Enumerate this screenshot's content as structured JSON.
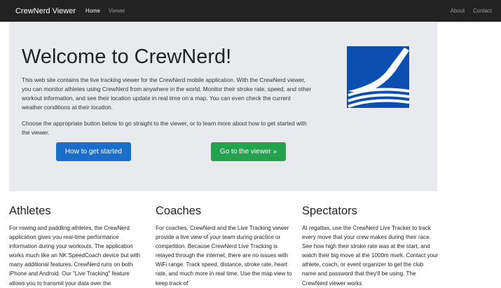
{
  "navbar": {
    "brand": "CrewNerd Viewer",
    "left_links": [
      {
        "label": "Home",
        "active": true
      },
      {
        "label": "Viewer",
        "active": false
      }
    ],
    "right_links": [
      {
        "label": "About"
      },
      {
        "label": "Contact"
      }
    ]
  },
  "jumbotron": {
    "title": "Welcome to CrewNerd!",
    "paragraph1": "This web site contains the live tracking viewer for the CrewNerd mobile application. With the CrewNerd viewer, you can monitor athletes using CrewNerd from anywhere in the world. Monitor their stroke rate, speed, and other workout information, and see their location update in real time on a map. You can even check the current weather conditions at their location.",
    "paragraph2": "Choose the appropriate button below to go straight to the viewer, or to learn more about how to get started with the viewer.",
    "btn_get_started": "How to get started",
    "btn_viewer": "Go to the viewer »",
    "logo_icon": "crewnerd-oar-logo-icon",
    "logo_color": "#0b4fb0"
  },
  "columns": [
    {
      "heading": "Athletes",
      "text": "For rowing and paddling athletes, the CrewNerd application gives you real-time performance information during your workouts. The application works much like an NK SpeedCoach device but with many additional features. CrewNerd runs on both iPhone and Android. Our \"Live Tracking\" feature allows you to transmit your data over the"
    },
    {
      "heading": "Coaches",
      "text": "For coaches, CrewNerd and the Live Tracking viewer provide a live view of your team during practice or competition. Because CrewNerd Live Tracking is relayed through the internet, there are no issues with WiFi range. Track speed, distance, stroke rate, heart rate, and much more in real time. Use the map view to keep track of"
    },
    {
      "heading": "Spectators",
      "text": "At regattas, use the CrewNerd Live Tracker to track every move that your crew makes during their race. See how high their stroke rate was at the start, and watch their big move at the 1000m mark. Contact your athlete, coach, or event organizer to get the club name and password that they'll be using. The CrewNerd viewer works"
    }
  ]
}
